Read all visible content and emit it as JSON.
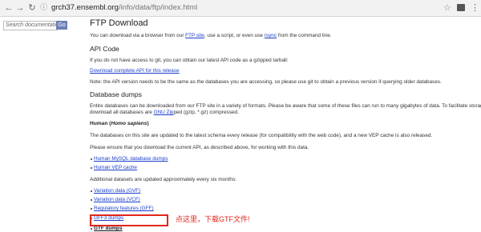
{
  "browser": {
    "url_host": "grch37.ensembl.org",
    "url_path": "/info/data/ftp/index.html"
  },
  "sidebar": {
    "search_placeholder": "Search documentation",
    "go_label": "Go"
  },
  "main": {
    "title": "FTP Download",
    "intro": {
      "pre": "You can download via a browser from our ",
      "ftp_link": "FTP site",
      "mid": ", use a script, or even use ",
      "rsync_link": "rsync",
      "post": " from the command line."
    },
    "api": {
      "heading": "API Code",
      "text": "If you do not have access to git, you can obtain our latest API code as a gzipped tarball:",
      "link": "Download complete API for this release",
      "note": "Note: the API version needs to be the same as the databases you are accessing, so please use git to obtain a previous version if querying older databases."
    },
    "dumps": {
      "heading": "Database dumps",
      "text1": "Entire databases can be downloaded from our FTP site in a variety of formats. Please be aware that some of these files can run to many gigabytes of data. To facilitate storage and",
      "text2_pre": "download all databases are ",
      "gnu_link": "GNU Zip",
      "text2_post": "ped (gzip, *.gz) compressed."
    },
    "human": {
      "heading_pre": "Human (",
      "heading_species": "Homo sapiens",
      "heading_post": ")",
      "text1": "The databases on this site are updated to the latest schema every release (for compatibility with the web code), and a new VEP cache is also released.",
      "text2": "Please ensure that you download the current API, as described above, for working with this data.",
      "links": [
        "Human MySQL database dumps",
        "Human VEP cache"
      ]
    },
    "additional": {
      "text": "Additional datasets are updated approximately every six months:",
      "links": [
        "Variation data (GVF)",
        "Variation data (VCF)",
        "Regulatory features (GFF)",
        "GFF3 dumps",
        "GTF dumps"
      ]
    }
  },
  "annotation": {
    "text": "点这里，下载GTF文件!",
    "color": "#e0261b"
  }
}
